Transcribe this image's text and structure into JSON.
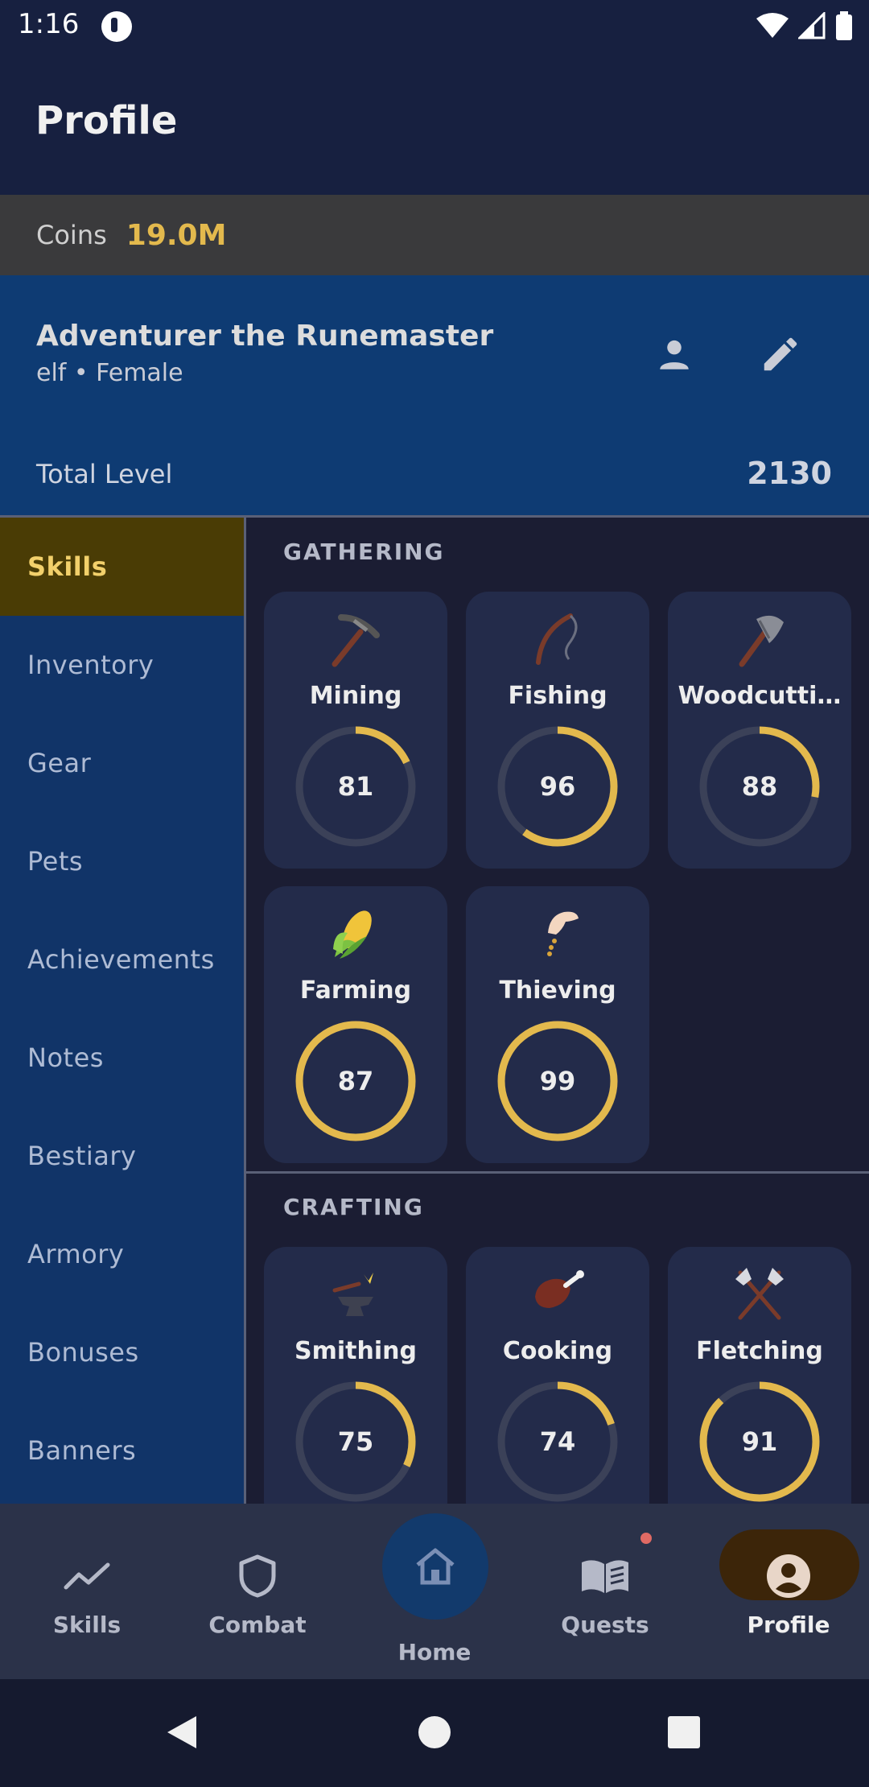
{
  "status_bar": {
    "time": "1:16"
  },
  "app_bar": {
    "title": "Profile"
  },
  "coins": {
    "label": "Coins",
    "value": "19.0M"
  },
  "character": {
    "name": "Adventurer the Runemaster",
    "subtitle": "elf • Female",
    "total_level_label": "Total Level",
    "total_level_value": "2130"
  },
  "side_nav": {
    "items": [
      {
        "label": "Skills",
        "active": true
      },
      {
        "label": "Inventory"
      },
      {
        "label": "Gear"
      },
      {
        "label": "Pets"
      },
      {
        "label": "Achievements"
      },
      {
        "label": "Notes"
      },
      {
        "label": "Bestiary"
      },
      {
        "label": "Armory"
      },
      {
        "label": "Bonuses"
      },
      {
        "label": "Banners"
      }
    ]
  },
  "sections": [
    {
      "title": "GATHERING",
      "skills": [
        {
          "name": "Mining",
          "level": "81",
          "progress": 0.18,
          "icon": "pickaxe-icon"
        },
        {
          "name": "Fishing",
          "level": "96",
          "progress": 0.6,
          "icon": "fishing-rod-icon"
        },
        {
          "name": "Woodcutti…",
          "level": "88",
          "progress": 0.28,
          "icon": "axe-icon"
        },
        {
          "name": "Farming",
          "level": "87",
          "progress": 1.0,
          "icon": "corn-icon"
        },
        {
          "name": "Thieving",
          "level": "99",
          "progress": 1.0,
          "icon": "thieving-hand-icon"
        }
      ]
    },
    {
      "title": "CRAFTING",
      "skills": [
        {
          "name": "Smithing",
          "level": "75",
          "progress": 0.32,
          "icon": "anvil-icon"
        },
        {
          "name": "Cooking",
          "level": "74",
          "progress": 0.2,
          "icon": "meat-icon"
        },
        {
          "name": "Fletching",
          "level": "91",
          "progress": 0.88,
          "icon": "crossed-axes-icon"
        }
      ]
    }
  ],
  "bottom_nav": {
    "items": [
      {
        "label": "Skills",
        "icon": "trend-line-icon"
      },
      {
        "label": "Combat",
        "icon": "shield-icon"
      },
      {
        "label": "Home",
        "icon": "home-icon"
      },
      {
        "label": "Quests",
        "icon": "book-icon"
      },
      {
        "label": "Profile",
        "icon": "account-circle-icon",
        "active": true
      }
    ]
  },
  "colors": {
    "accent_gold": "#e3b94d",
    "ring_track": "#3b4158",
    "nav_active_bg": "#4a3c05",
    "character_bg": "#0e3b73"
  }
}
